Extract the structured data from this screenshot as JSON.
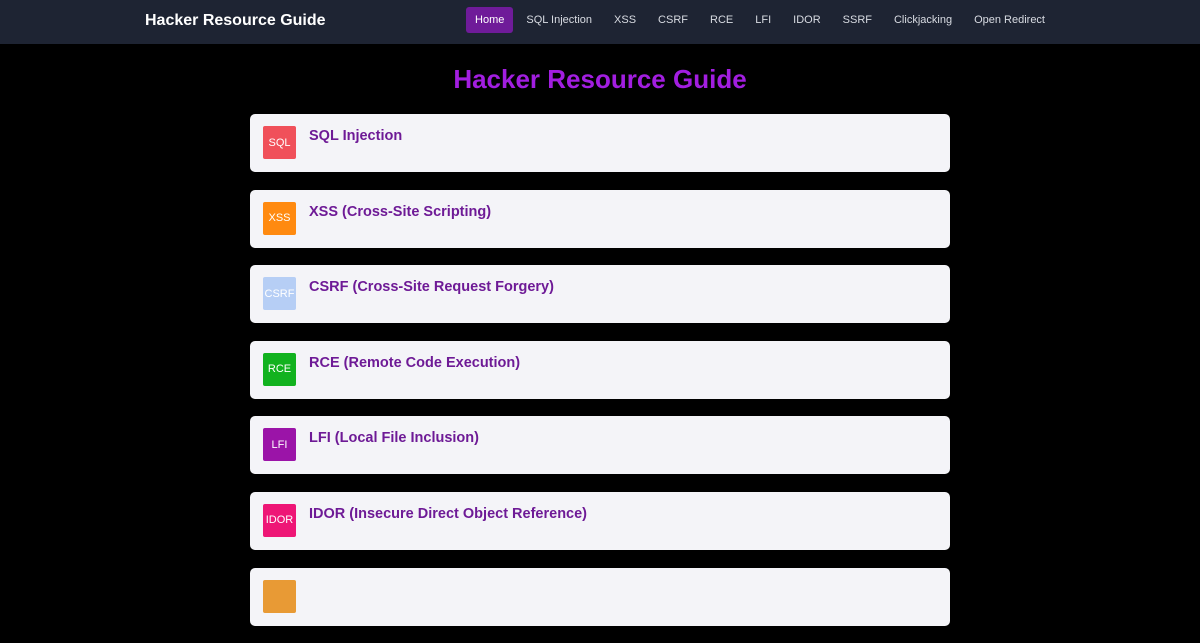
{
  "navbar": {
    "brand": "Hacker Resource Guide",
    "links": [
      {
        "label": "Home",
        "active": true
      },
      {
        "label": "SQL Injection",
        "active": false
      },
      {
        "label": "XSS",
        "active": false
      },
      {
        "label": "CSRF",
        "active": false
      },
      {
        "label": "RCE",
        "active": false
      },
      {
        "label": "LFI",
        "active": false
      },
      {
        "label": "IDOR",
        "active": false
      },
      {
        "label": "SSRF",
        "active": false
      },
      {
        "label": "Clickjacking",
        "active": false
      },
      {
        "label": "Open Redirect",
        "active": false
      }
    ]
  },
  "main": {
    "title": "Hacker Resource Guide",
    "cards": [
      {
        "icon_text": "SQL",
        "icon_color": "#f0505a",
        "title": "SQL Injection"
      },
      {
        "icon_text": "XSS",
        "icon_color": "#ff8a10",
        "title": "XSS (Cross-Site Scripting)"
      },
      {
        "icon_text": "CSRF",
        "icon_color": "#b6cef5",
        "title": "CSRF (Cross-Site Request Forgery)"
      },
      {
        "icon_text": "RCE",
        "icon_color": "#12b21f",
        "title": "RCE (Remote Code Execution)"
      },
      {
        "icon_text": "LFI",
        "icon_color": "#9b14a8",
        "title": "LFI (Local File Inclusion)"
      },
      {
        "icon_text": "IDOR",
        "icon_color": "#ee1676",
        "title": "IDOR (Insecure Direct Object Reference)"
      },
      {
        "icon_text": "",
        "icon_color": "#e89a35",
        "title": ""
      }
    ]
  },
  "colors": {
    "background": "#000000",
    "navbar_bg": "#1e2433",
    "accent": "#a21ee0",
    "active_nav": "#6f1b99",
    "card_bg": "#f4f4f8",
    "card_title": "#6e1a96"
  }
}
